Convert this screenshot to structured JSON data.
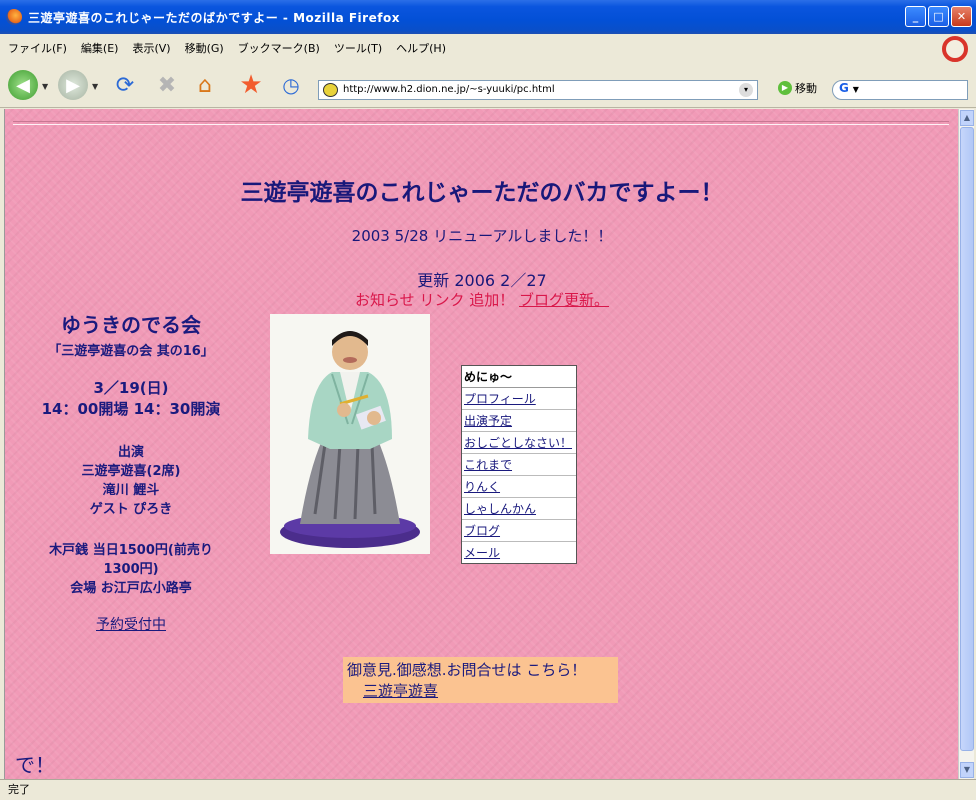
{
  "window": {
    "title": "三遊亭遊喜のこれじゃーただのばかですよー - Mozilla Firefox"
  },
  "menubar": {
    "items": [
      "ファイル(F)",
      "編集(E)",
      "表示(V)",
      "移動(G)",
      "ブックマーク(B)",
      "ツール(T)",
      "ヘルプ(H)"
    ]
  },
  "toolbar": {
    "url": "http://www.h2.dion.ne.jp/~s-yuuki/pc.html",
    "go_label": "移動",
    "search_engine": "G"
  },
  "status": {
    "text": "完了"
  },
  "page": {
    "main_title": "三遊亭遊喜のこれじゃーただのバカですよー！",
    "renewal": "2003  5/28 リニューアルしました！！",
    "update": "更新  2006  2／27",
    "notice_text": "お知らせ  リンク  追加！  ",
    "notice_link": "ブログ更新。",
    "event": {
      "title": "ゆうきのでる会",
      "subtitle": "「三遊亭遊喜の会  其の16」",
      "date": "3／19(日)",
      "time": "14：00開場  14：30開演",
      "cast_heading": "出演",
      "cast_1": "三遊亭遊喜(2席)",
      "cast_2": "滝川  鯉斗",
      "cast_3": "ゲスト  ぴろき",
      "price_1": "木戸銭  当日1500円(前売り",
      "price_2": "1300円)",
      "venue": "会場  お江戸広小路亭",
      "reserve": "予約受付中"
    },
    "menu": {
      "header": "めにゅ～",
      "items": [
        "プロフィール",
        "出演予定",
        "おしごとしなさい！",
        "これまで",
        "りんく",
        "しゃしんかん",
        "ブログ",
        "メール"
      ]
    },
    "contact": {
      "text": "御意見.御感想.お問合せは こちら！",
      "name": "三遊亭遊喜"
    },
    "footer": "で！"
  },
  "colors": {
    "page_bg": "#f19ab7",
    "title_text": "#18187a",
    "notice_text": "#d9174a",
    "contact_bg": "#fbc391"
  }
}
